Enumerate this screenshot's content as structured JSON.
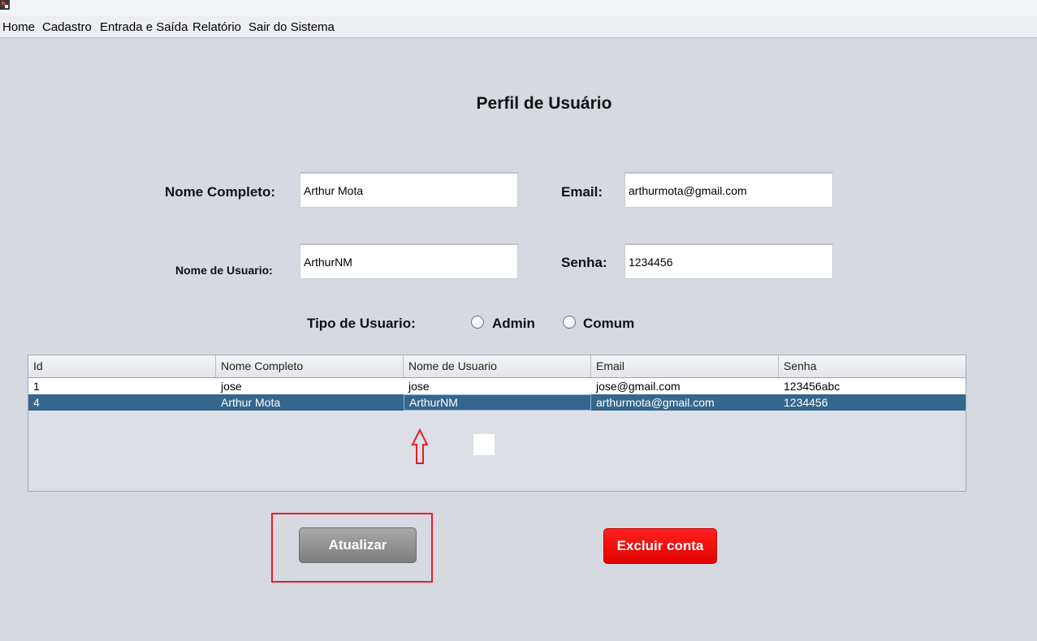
{
  "menu": [
    "Home",
    "Cadastro",
    "Entrada e Saída",
    "Relatório",
    "Sair do Sistema"
  ],
  "title": "Perfil de Usuário",
  "form": {
    "nome_completo": {
      "label": "Nome Completo:",
      "value": "Arthur Mota"
    },
    "email": {
      "label": "Email:",
      "value": "arthurmota@gmail.com"
    },
    "nome_usuario": {
      "label": "Nome de Usuario:",
      "value": "ArthurNM"
    },
    "senha": {
      "label": "Senha:",
      "value": "1234456"
    },
    "tipo_usuario": {
      "label": "Tipo de Usuario:",
      "options": [
        "Admin",
        "Comum"
      ]
    }
  },
  "table": {
    "columns": [
      "Id",
      "Nome Completo",
      "Nome de Usuario",
      "Email",
      "Senha"
    ],
    "rows": [
      [
        "1",
        "jose",
        "jose",
        "jose@gmail.com",
        "123456abc"
      ],
      [
        "4",
        "Arthur Mota",
        "ArthurNM",
        "arthurmota@gmail.com",
        "1234456"
      ]
    ],
    "selected_row": 1
  },
  "buttons": {
    "update": "Atualizar",
    "delete": "Excluir conta"
  },
  "colors": {
    "background": "#d6d9e0",
    "selected_row": "#35668b",
    "delete_button": "#ff0000",
    "update_button": "#8a8a8a",
    "annotation": "#e0202a"
  },
  "icons": [
    "app-icon",
    "arrow-up-icon"
  ]
}
